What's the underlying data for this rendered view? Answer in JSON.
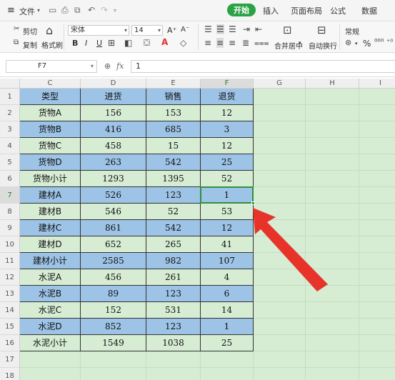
{
  "menubar": {
    "menu_icon": "≡",
    "file_label": "文件",
    "tabs": [
      "开始",
      "插入",
      "页面布局",
      "公式",
      "数据"
    ],
    "active_tab": "开始"
  },
  "toolbar": {
    "cut_label": "剪切",
    "copy_label": "复制",
    "format_painter_label": "格式刷",
    "font_name": "宋体",
    "font_size": "14",
    "merge_center_label": "合并居中",
    "wrap_label": "自动换行",
    "number_format": "常规",
    "bold": "B",
    "italic": "I",
    "underline": "U",
    "grow_font": "A⁺",
    "shrink_font": "A⁻",
    "percent": "%",
    "comma": "⁰⁰⁰"
  },
  "formula_bar": {
    "name_box": "F7",
    "fx_label": "fx",
    "value": "1"
  },
  "sheet": {
    "columns": [
      "C",
      "D",
      "E",
      "F",
      "G",
      "H",
      "I"
    ],
    "selected_column": "F",
    "selected_row": "7",
    "rows": [
      "1",
      "2",
      "3",
      "4",
      "5",
      "6",
      "7",
      "8",
      "9",
      "10",
      "11",
      "12",
      "13",
      "14",
      "15",
      "16",
      "17",
      "18"
    ],
    "table": [
      {
        "c": "类型",
        "d": "进货",
        "e": "销售",
        "f": "退货",
        "fill": "blue"
      },
      {
        "c": "货物A",
        "d": "156",
        "e": "153",
        "f": "12",
        "fill": "green"
      },
      {
        "c": "货物B",
        "d": "416",
        "e": "685",
        "f": "3",
        "fill": "blue"
      },
      {
        "c": "货物C",
        "d": "458",
        "e": "15",
        "f": "12",
        "fill": "green"
      },
      {
        "c": "货物D",
        "d": "263",
        "e": "542",
        "f": "25",
        "fill": "blue"
      },
      {
        "c": "货物小计",
        "d": "1293",
        "e": "1395",
        "f": "52",
        "fill": "green"
      },
      {
        "c": "建材A",
        "d": "526",
        "e": "123",
        "f": "1",
        "fill": "blue"
      },
      {
        "c": "建材B",
        "d": "546",
        "e": "52",
        "f": "53",
        "fill": "green"
      },
      {
        "c": "建材C",
        "d": "861",
        "e": "542",
        "f": "12",
        "fill": "blue"
      },
      {
        "c": "建材D",
        "d": "652",
        "e": "265",
        "f": "41",
        "fill": "green"
      },
      {
        "c": "建材小计",
        "d": "2585",
        "e": "982",
        "f": "107",
        "fill": "blue"
      },
      {
        "c": "水泥A",
        "d": "456",
        "e": "261",
        "f": "4",
        "fill": "green"
      },
      {
        "c": "水泥B",
        "d": "89",
        "e": "123",
        "f": "6",
        "fill": "blue"
      },
      {
        "c": "水泥C",
        "d": "152",
        "e": "531",
        "f": "14",
        "fill": "green"
      },
      {
        "c": "水泥D",
        "d": "852",
        "e": "123",
        "f": "1",
        "fill": "blue"
      },
      {
        "c": "水泥小计",
        "d": "1549",
        "e": "1038",
        "f": "25",
        "fill": "green"
      }
    ]
  },
  "colors": {
    "accent": "#2ba245",
    "sheet_background": "#d6ecd3",
    "blue_fill": "#9dc3e6",
    "arrow": "#e8332b",
    "selection": "#2f8f3f"
  }
}
